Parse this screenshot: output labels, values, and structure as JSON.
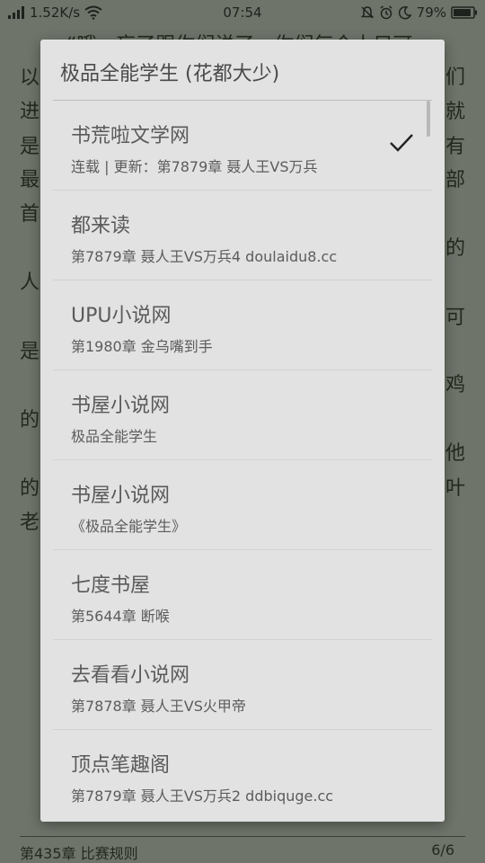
{
  "status_bar": {
    "speed": "1.52K/s",
    "time": "07:54",
    "battery": "79%"
  },
  "reader": {
    "lines": [
      "“哦，忘了跟你们说了，你们每个人只可",
      "以",
      "们",
      "进",
      "就",
      "是",
      "有",
      "最",
      "部",
      "首",
      "的",
      "人",
      "可",
      "是",
      "鸡",
      "的",
      "他",
      "的",
      "叶",
      "老"
    ],
    "footer_chapter": "第435章 比赛规则",
    "footer_page": "6/6"
  },
  "dialog": {
    "title": "极品全能学生 (花都大少)",
    "sources": [
      {
        "name": "书荒啦文学网",
        "desc": "连载 | 更新：第7879章 聂人王VS万兵",
        "selected": true
      },
      {
        "name": "都来读",
        "desc": "第7879章 聂人王VS万兵4 doulaidu8.cc",
        "selected": false
      },
      {
        "name": "UPU小说网",
        "desc": "第1980章 金乌嘴到手",
        "selected": false
      },
      {
        "name": "书屋小说网",
        "desc": "极品全能学生",
        "selected": false
      },
      {
        "name": "书屋小说网",
        "desc": "《极品全能学生》",
        "selected": false
      },
      {
        "name": "七度书屋",
        "desc": "第5644章 断喉",
        "selected": false
      },
      {
        "name": "去看看小说网",
        "desc": "第7878章 聂人王VS火甲帝",
        "selected": false
      },
      {
        "name": "顶点笔趣阁",
        "desc": "第7879章 聂人王VS万兵2 ddbiquge.cc",
        "selected": false
      }
    ]
  }
}
